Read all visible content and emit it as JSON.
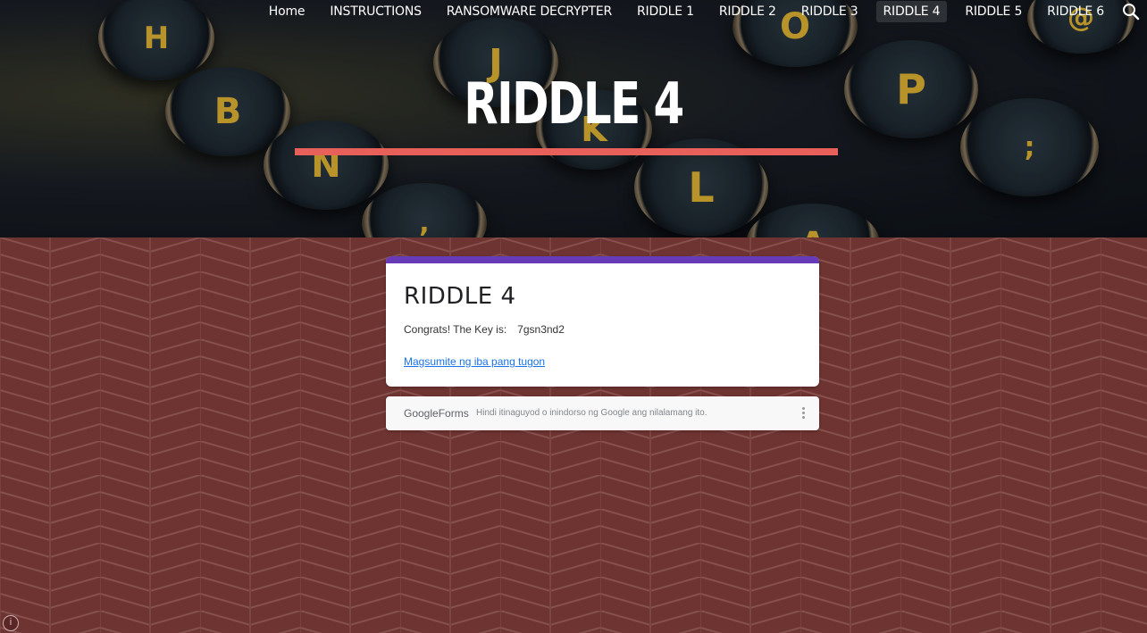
{
  "nav": {
    "items": [
      "Home",
      "INSTRUCTIONS",
      "RANSOMWARE DECRYPTER",
      "RIDDLE 1",
      "RIDDLE 2",
      "RIDDLE 3",
      "RIDDLE 4",
      "RIDDLE 5",
      "RIDDLE 6"
    ],
    "active": "RIDDLE 4",
    "search_icon": "search-icon"
  },
  "hero": {
    "title": "RIDDLE 4",
    "accent_color": "#e8605a"
  },
  "form": {
    "title": "RIDDLE 4",
    "message": "Congrats! The Key is:",
    "key": "7gsn3nd2",
    "link_text": "Magsumite ng iba pang tugon",
    "header_color": "#673ab7"
  },
  "footer": {
    "brand_google": "Google",
    "brand_forms": "Forms",
    "disclaimer": "Hindi itinaguyod o inindorso ng Google ang nilalamang ito."
  },
  "colors": {
    "page_background": "#6e3432",
    "link": "#1a73e8"
  }
}
